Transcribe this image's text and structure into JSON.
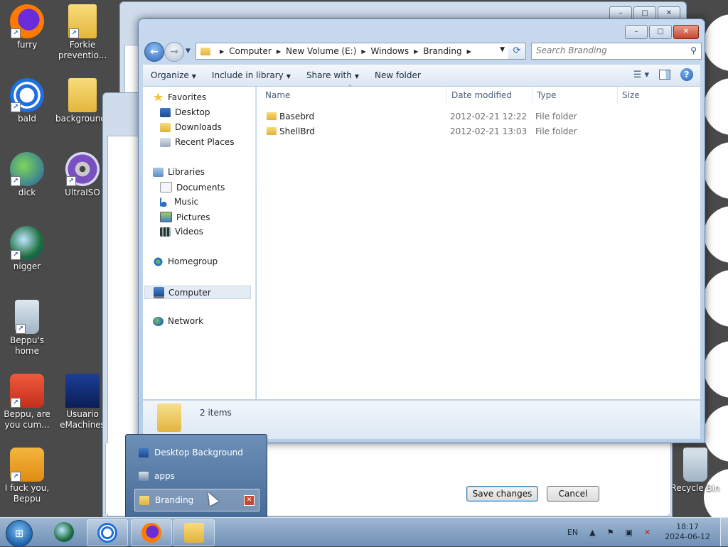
{
  "desktop": {
    "icons": [
      {
        "label": "furry"
      },
      {
        "label": "Forkie preventio..."
      },
      {
        "label": "bald"
      },
      {
        "label": "backgrounds"
      },
      {
        "label": "dick"
      },
      {
        "label": "UltraISO"
      },
      {
        "label": "nigger"
      },
      {
        "label": "Beppu's home"
      },
      {
        "label": "Beppu, are you cum..."
      },
      {
        "label": "Usuario eMachines"
      },
      {
        "label": "I fuck you, Beppu"
      },
      {
        "label": "Recycle Bin"
      }
    ]
  },
  "explorer": {
    "breadcrumb": [
      "Computer",
      "New Volume (E:)",
      "Windows",
      "Branding"
    ],
    "search_placeholder": "Search Branding",
    "toolbar": {
      "organize": "Organize",
      "include": "Include in library",
      "share": "Share with",
      "new_folder": "New folder"
    },
    "nav": {
      "favorites": "Favorites",
      "desktop": "Desktop",
      "downloads": "Downloads",
      "recent": "Recent Places",
      "libraries": "Libraries",
      "documents": "Documents",
      "music": "Music",
      "pictures": "Pictures",
      "videos": "Videos",
      "homegroup": "Homegroup",
      "computer": "Computer",
      "network": "Network"
    },
    "columns": {
      "name": "Name",
      "date": "Date modified",
      "type": "Type",
      "size": "Size"
    },
    "files": [
      {
        "name": "Basebrd",
        "date": "2012-02-21 12:22",
        "type": "File folder"
      },
      {
        "name": "ShellBrd",
        "date": "2012-02-21 13:03",
        "type": "File folder"
      }
    ],
    "status": "2 items"
  },
  "dialog": {
    "save": "Save changes",
    "cancel": "Cancel"
  },
  "jumplist": {
    "items": [
      "Desktop Background",
      "apps",
      "Branding"
    ]
  },
  "taskbar": {
    "lang": "EN",
    "time": "18:17",
    "date": "2024-06-12"
  }
}
